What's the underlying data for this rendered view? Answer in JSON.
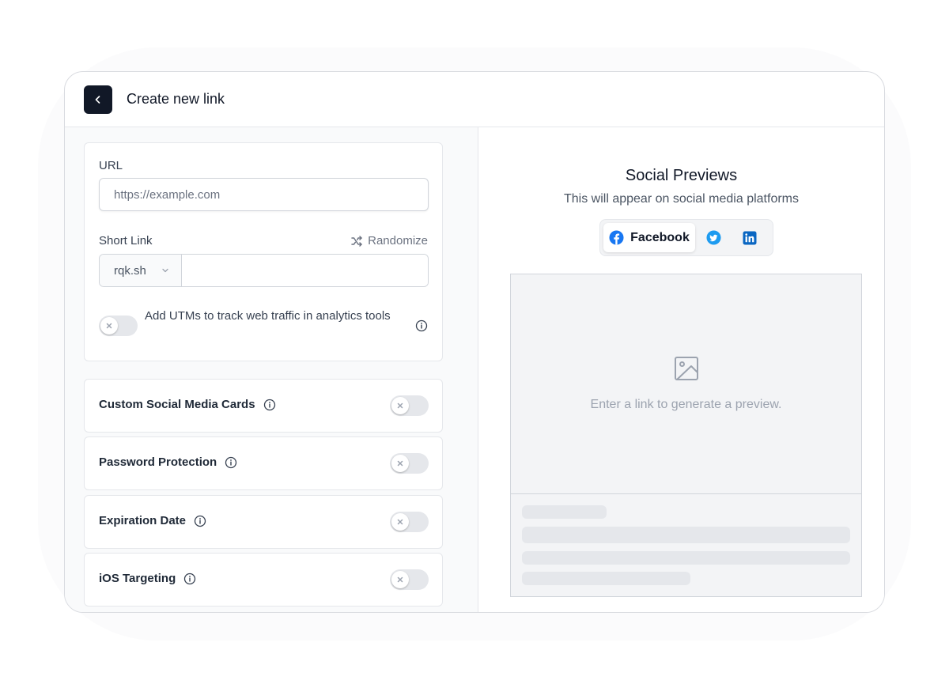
{
  "header": {
    "title": "Create new link",
    "back_icon": "chevron-left-icon"
  },
  "url_section": {
    "label": "URL",
    "placeholder": "https://example.com",
    "value": ""
  },
  "short_link": {
    "label": "Short Link",
    "randomize_label": "Randomize",
    "domain": "rqk.sh",
    "key": ""
  },
  "utm": {
    "text": "Add UTMs to track web traffic in analytics tools",
    "enabled": false
  },
  "options": [
    {
      "label": "Custom Social Media Cards",
      "enabled": false
    },
    {
      "label": "Password Protection",
      "enabled": false
    },
    {
      "label": "Expiration Date",
      "enabled": false
    },
    {
      "label": "iOS Targeting",
      "enabled": false
    }
  ],
  "social": {
    "title": "Social Previews",
    "subtitle": "This will appear on social media platforms",
    "tabs": [
      {
        "label": "Facebook",
        "icon": "facebook-icon",
        "active": true
      },
      {
        "label": "",
        "icon": "twitter-icon",
        "active": false
      },
      {
        "label": "",
        "icon": "linkedin-icon",
        "active": false
      }
    ],
    "preview_message": "Enter a link to generate a preview."
  },
  "colors": {
    "primary": "#111827",
    "facebook": "#1877f2",
    "twitter": "#1d9bf0",
    "linkedin": "#0a66c2",
    "muted": "#9ca3af"
  }
}
